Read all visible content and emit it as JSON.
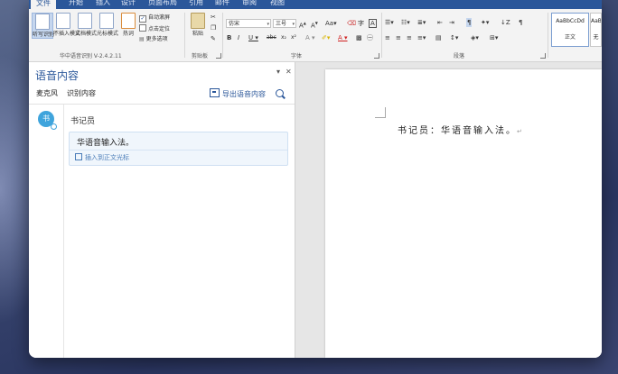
{
  "tabs": [
    "文件",
    "开始",
    "插入",
    "设计",
    "页面布局",
    "引用",
    "邮件",
    "审阅",
    "视图"
  ],
  "ribbon": {
    "plugin_buttons": [
      "听写识别",
      "不插入模式",
      "文档模式",
      "光标模式",
      "热词"
    ],
    "plugin_checks": [
      "自动滚屏",
      "点击定位",
      "更多选项"
    ],
    "plugin_group": "华中语音识别 V-2.4.2.11",
    "paste_label": "粘贴",
    "clipboard_group": "剪贴板",
    "font_name": "仿宋",
    "font_size": "三号",
    "font_group": "字体",
    "paragraph_group": "段落",
    "styles": [
      {
        "sample": "AaBbCcDd",
        "name": "正文"
      },
      {
        "sample": "AaB",
        "name": "无"
      }
    ]
  },
  "pane": {
    "title": "语音内容",
    "mic_label": "麦克风",
    "recognize_label": "识别内容",
    "export_label": "导出语音内容",
    "avatar_text": "书",
    "speaker": "书记员",
    "message": "华语音输入法。",
    "insert_label": "插入到正文光标"
  },
  "document": {
    "line": "书记员：华语音输入法。",
    "para_mark": "↵"
  },
  "colors": {
    "accent": "#2b579a",
    "avatar": "#3fa4dc"
  }
}
